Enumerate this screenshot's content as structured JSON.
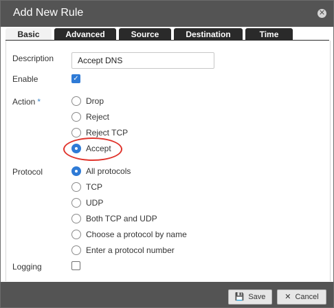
{
  "dialog": {
    "title": "Add New Rule",
    "close_icon": "close-icon"
  },
  "tabs": [
    {
      "label": "Basic",
      "active": true
    },
    {
      "label": "Advanced",
      "active": false
    },
    {
      "label": "Source",
      "active": false
    },
    {
      "label": "Destination",
      "active": false
    },
    {
      "label": "Time",
      "active": false
    }
  ],
  "form": {
    "description_label": "Description",
    "description_value": "Accept DNS",
    "enable_label": "Enable",
    "enable_checked": true,
    "action_label": "Action",
    "required_marker": "*",
    "action_options": [
      {
        "label": "Drop",
        "selected": false
      },
      {
        "label": "Reject",
        "selected": false
      },
      {
        "label": "Reject TCP",
        "selected": false
      },
      {
        "label": "Accept",
        "selected": true
      }
    ],
    "protocol_label": "Protocol",
    "protocol_options": [
      {
        "label": "All protocols",
        "selected": true
      },
      {
        "label": "TCP",
        "selected": false
      },
      {
        "label": "UDP",
        "selected": false
      },
      {
        "label": "Both TCP and UDP",
        "selected": false
      },
      {
        "label": "Choose a protocol by name",
        "selected": false
      },
      {
        "label": "Enter a protocol number",
        "selected": false
      }
    ],
    "logging_label": "Logging",
    "logging_checked": false
  },
  "footer": {
    "save_label": "Save",
    "save_icon": "floppy-disk-icon",
    "cancel_label": "Cancel",
    "cancel_icon": "close-icon"
  },
  "colors": {
    "titlebar": "#545454",
    "accent": "#2f7bd6",
    "annotation": "#e0332b"
  }
}
